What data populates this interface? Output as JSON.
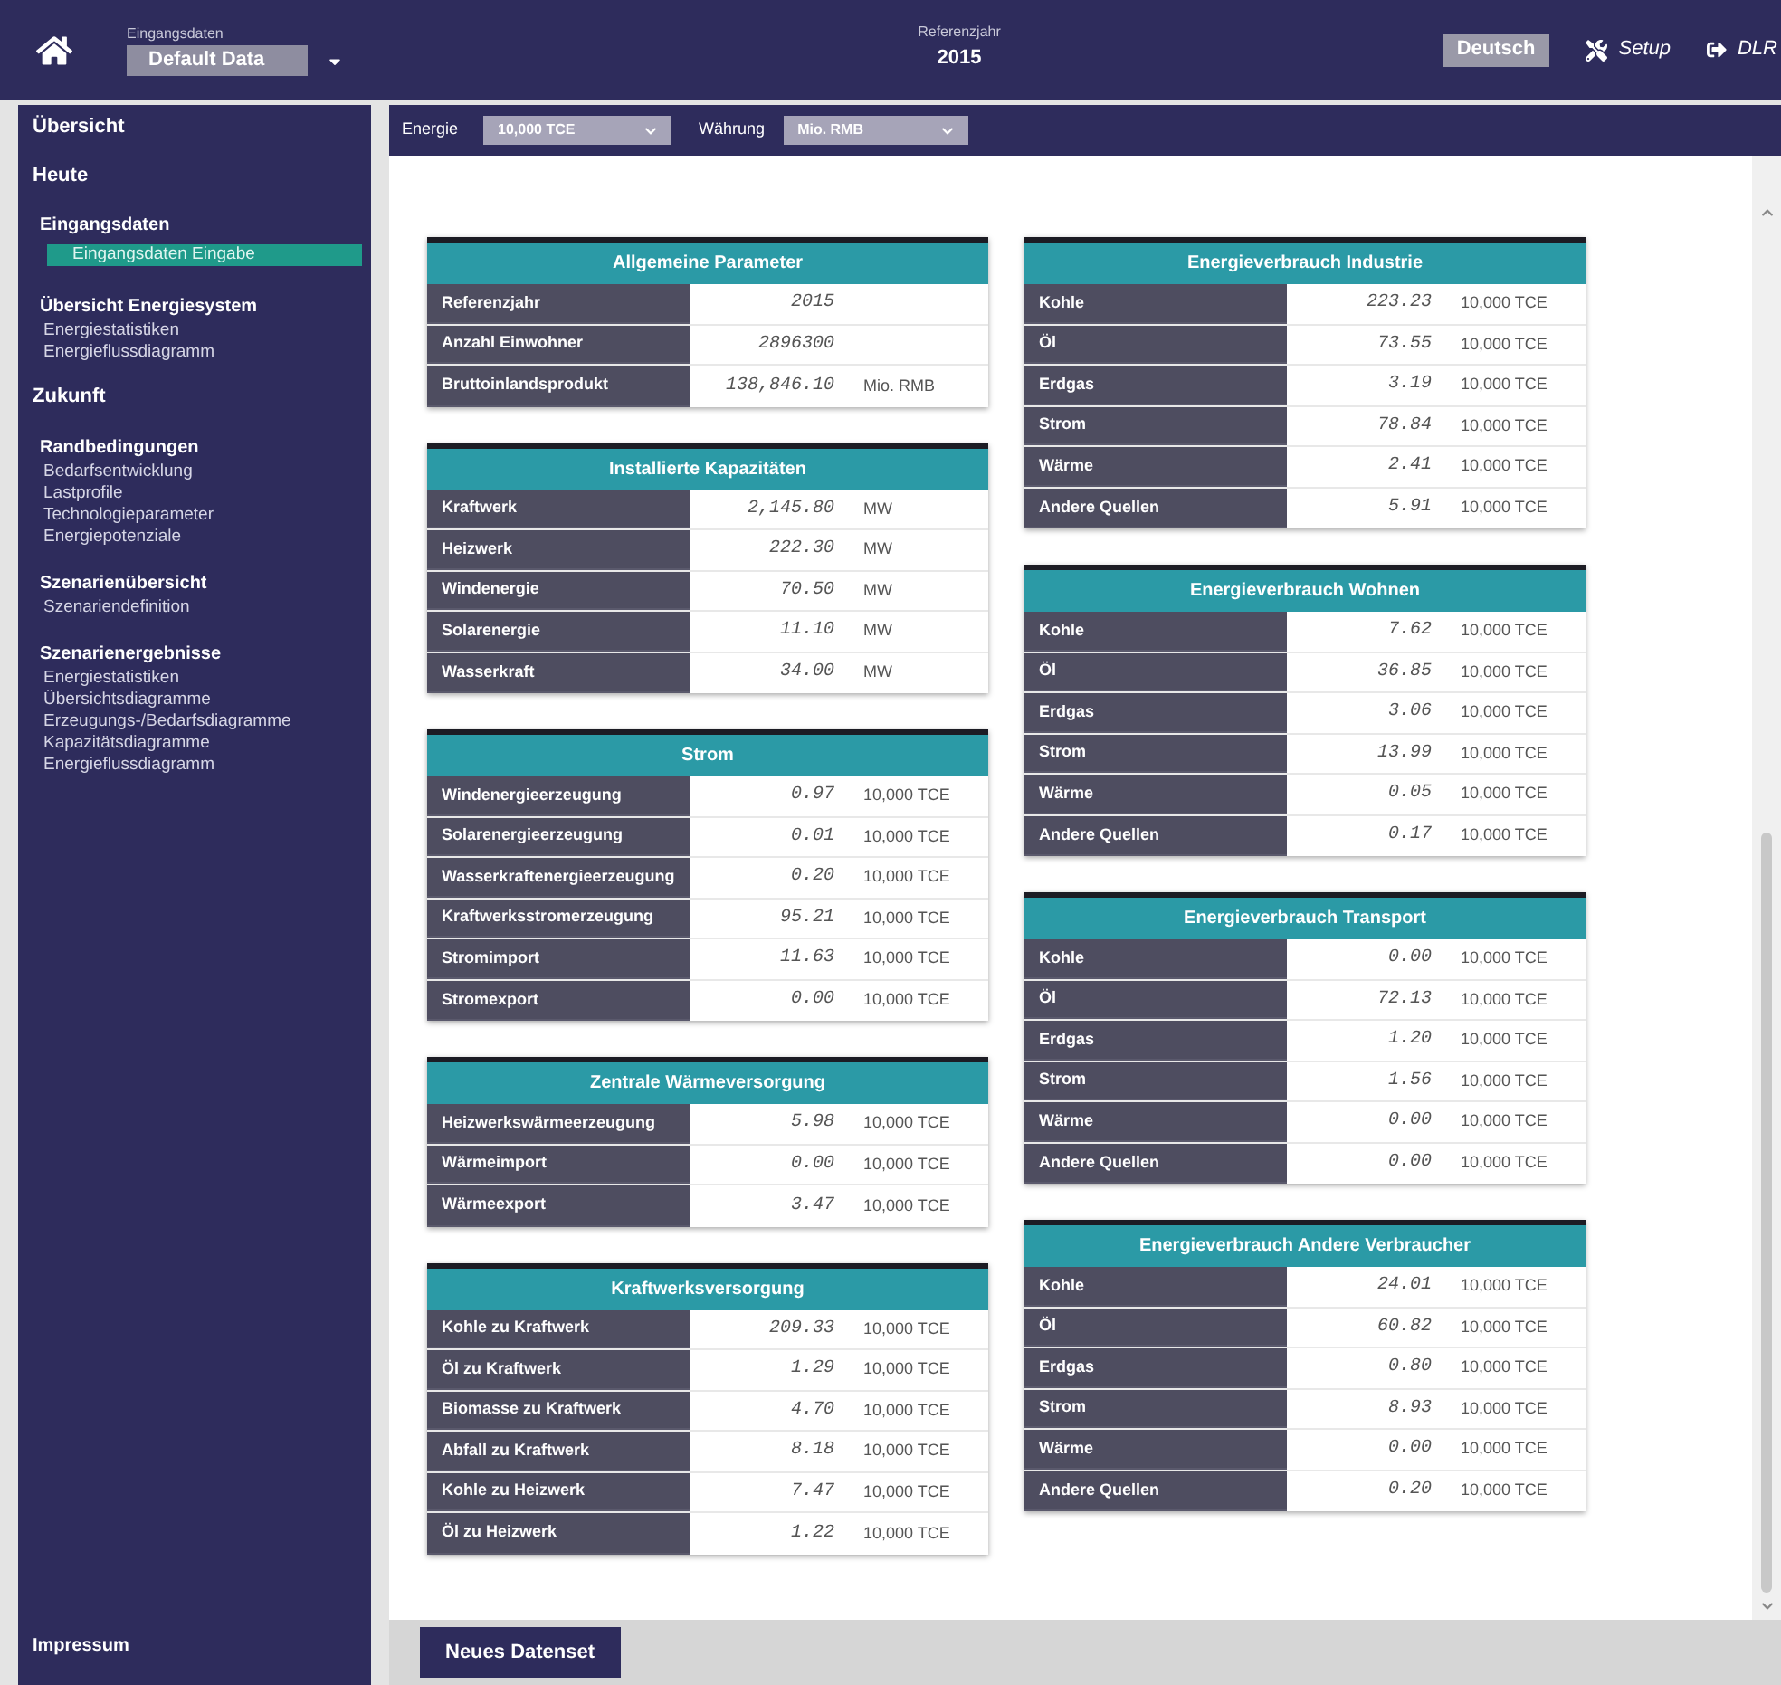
{
  "header": {
    "input_label": "Eingangsdaten",
    "input_value": "Default Data",
    "year_label": "Referenzjahr",
    "year_value": "2015",
    "language": "Deutsch",
    "setup": "Setup",
    "logout": "DLR"
  },
  "toolbar": {
    "energy_label": "Energie",
    "energy_value": "10,000 TCE",
    "currency_label": "Währung",
    "currency_value": "Mio. RMB"
  },
  "sidebar": {
    "items": [
      {
        "kind": "top",
        "label": "Übersicht",
        "selected": false
      },
      {
        "kind": "top",
        "label": "Heute",
        "selected": false
      },
      {
        "kind": "group",
        "label": "Eingangsdaten",
        "selected": false
      },
      {
        "kind": "link",
        "label": "Eingangsdaten Eingabe",
        "selected": true
      },
      {
        "kind": "group",
        "label": "Übersicht Energiesystem",
        "selected": false
      },
      {
        "kind": "link",
        "label": "Energiestatistiken",
        "selected": false
      },
      {
        "kind": "link",
        "label": "Energieflussdiagramm",
        "selected": false
      },
      {
        "kind": "top",
        "label": "Zukunft",
        "selected": false
      },
      {
        "kind": "group",
        "label": "Randbedingungen",
        "selected": false
      },
      {
        "kind": "link",
        "label": "Bedarfsentwicklung",
        "selected": false
      },
      {
        "kind": "link",
        "label": "Lastprofile",
        "selected": false
      },
      {
        "kind": "link",
        "label": "Technologieparameter",
        "selected": false
      },
      {
        "kind": "link",
        "label": "Energiepotenziale",
        "selected": false
      },
      {
        "kind": "group",
        "label": "Szenarienübersicht",
        "selected": false
      },
      {
        "kind": "link",
        "label": "Szenariendefinition",
        "selected": false
      },
      {
        "kind": "group",
        "label": "Szenarienergebnisse",
        "selected": false
      },
      {
        "kind": "link",
        "label": "Energiestatistiken",
        "selected": false
      },
      {
        "kind": "link",
        "label": "Übersichtsdiagramme",
        "selected": false
      },
      {
        "kind": "link",
        "label": "Erzeugungs-/Bedarfsdiagramme",
        "selected": false
      },
      {
        "kind": "link",
        "label": "Kapazitätsdiagramme",
        "selected": false
      },
      {
        "kind": "link",
        "label": "Energieflussdiagramm",
        "selected": false
      }
    ],
    "footer": "Impressum"
  },
  "left_tables": [
    {
      "title": "Allgemeine Parameter",
      "rows": [
        {
          "label": "Referenzjahr",
          "value": "2015"
        },
        {
          "label": "Anzahl Einwohner",
          "value": "2896300"
        },
        {
          "label": "Bruttoinlandsprodukt",
          "value": "138,846.10",
          "unit": "Mio. RMB"
        }
      ]
    },
    {
      "title": "Installierte Kapazitäten",
      "rows": [
        {
          "label": "Kraftwerk",
          "value": "2,145.80",
          "unit": "MW"
        },
        {
          "label": "Heizwerk",
          "value": "222.30",
          "unit": "MW"
        },
        {
          "label": "Windenergie",
          "value": "70.50",
          "unit": "MW"
        },
        {
          "label": "Solarenergie",
          "value": "11.10",
          "unit": "MW"
        },
        {
          "label": "Wasserkraft",
          "value": "34.00",
          "unit": "MW"
        }
      ]
    },
    {
      "title": "Strom",
      "rows": [
        {
          "label": "Windenergieerzeugung",
          "value": "0.97",
          "unit": "10,000 TCE"
        },
        {
          "label": "Solarenergieerzeugung",
          "value": "0.01",
          "unit": "10,000 TCE"
        },
        {
          "label": "Wasserkraftenergieerzeugung",
          "value": "0.20",
          "unit": "10,000 TCE"
        },
        {
          "label": "Kraftwerksstromerzeugung",
          "value": "95.21",
          "unit": "10,000 TCE"
        },
        {
          "label": "Stromimport",
          "value": "11.63",
          "unit": "10,000 TCE"
        },
        {
          "label": "Stromexport",
          "value": "0.00",
          "unit": "10,000 TCE"
        }
      ]
    },
    {
      "title": "Zentrale Wärmeversorgung",
      "rows": [
        {
          "label": "Heizwerkswärmeerzeugung",
          "value": "5.98",
          "unit": "10,000 TCE"
        },
        {
          "label": "Wärmeimport",
          "value": "0.00",
          "unit": "10,000 TCE"
        },
        {
          "label": "Wärmeexport",
          "value": "3.47",
          "unit": "10,000 TCE"
        }
      ]
    },
    {
      "title": "Kraftwerksversorgung",
      "rows": [
        {
          "label": "Kohle zu Kraftwerk",
          "value": "209.33",
          "unit": "10,000 TCE"
        },
        {
          "label": "Öl zu Kraftwerk",
          "value": "1.29",
          "unit": "10,000 TCE"
        },
        {
          "label": "Biomasse zu Kraftwerk",
          "value": "4.70",
          "unit": "10,000 TCE"
        },
        {
          "label": "Abfall zu Kraftwerk",
          "value": "8.18",
          "unit": "10,000 TCE"
        },
        {
          "label": "Kohle zu Heizwerk",
          "value": "7.47",
          "unit": "10,000 TCE"
        },
        {
          "label": "Öl zu Heizwerk",
          "value": "1.22",
          "unit": "10,000 TCE"
        }
      ]
    }
  ],
  "right_tables": [
    {
      "title": "Energieverbrauch Industrie",
      "rows": [
        {
          "label": "Kohle",
          "value": "223.23",
          "unit": "10,000 TCE"
        },
        {
          "label": "Öl",
          "value": "73.55",
          "unit": "10,000 TCE"
        },
        {
          "label": "Erdgas",
          "value": "3.19",
          "unit": "10,000 TCE"
        },
        {
          "label": "Strom",
          "value": "78.84",
          "unit": "10,000 TCE"
        },
        {
          "label": "Wärme",
          "value": "2.41",
          "unit": "10,000 TCE"
        },
        {
          "label": "Andere Quellen",
          "value": "5.91",
          "unit": "10,000 TCE"
        }
      ]
    },
    {
      "title": "Energieverbrauch Wohnen",
      "rows": [
        {
          "label": "Kohle",
          "value": "7.62",
          "unit": "10,000 TCE"
        },
        {
          "label": "Öl",
          "value": "36.85",
          "unit": "10,000 TCE"
        },
        {
          "label": "Erdgas",
          "value": "3.06",
          "unit": "10,000 TCE"
        },
        {
          "label": "Strom",
          "value": "13.99",
          "unit": "10,000 TCE"
        },
        {
          "label": "Wärme",
          "value": "0.05",
          "unit": "10,000 TCE"
        },
        {
          "label": "Andere Quellen",
          "value": "0.17",
          "unit": "10,000 TCE"
        }
      ]
    },
    {
      "title": "Energieverbrauch Transport",
      "rows": [
        {
          "label": "Kohle",
          "value": "0.00",
          "unit": "10,000 TCE"
        },
        {
          "label": "Öl",
          "value": "72.13",
          "unit": "10,000 TCE"
        },
        {
          "label": "Erdgas",
          "value": "1.20",
          "unit": "10,000 TCE"
        },
        {
          "label": "Strom",
          "value": "1.56",
          "unit": "10,000 TCE"
        },
        {
          "label": "Wärme",
          "value": "0.00",
          "unit": "10,000 TCE"
        },
        {
          "label": "Andere Quellen",
          "value": "0.00",
          "unit": "10,000 TCE"
        }
      ]
    },
    {
      "title": "Energieverbrauch Andere Verbraucher",
      "rows": [
        {
          "label": "Kohle",
          "value": "24.01",
          "unit": "10,000 TCE"
        },
        {
          "label": "Öl",
          "value": "60.82",
          "unit": "10,000 TCE"
        },
        {
          "label": "Erdgas",
          "value": "0.80",
          "unit": "10,000 TCE"
        },
        {
          "label": "Strom",
          "value": "8.93",
          "unit": "10,000 TCE"
        },
        {
          "label": "Wärme",
          "value": "0.00",
          "unit": "10,000 TCE"
        },
        {
          "label": "Andere Quellen",
          "value": "0.20",
          "unit": "10,000 TCE"
        }
      ]
    }
  ],
  "new_dataset_button": "Neues Datenset"
}
